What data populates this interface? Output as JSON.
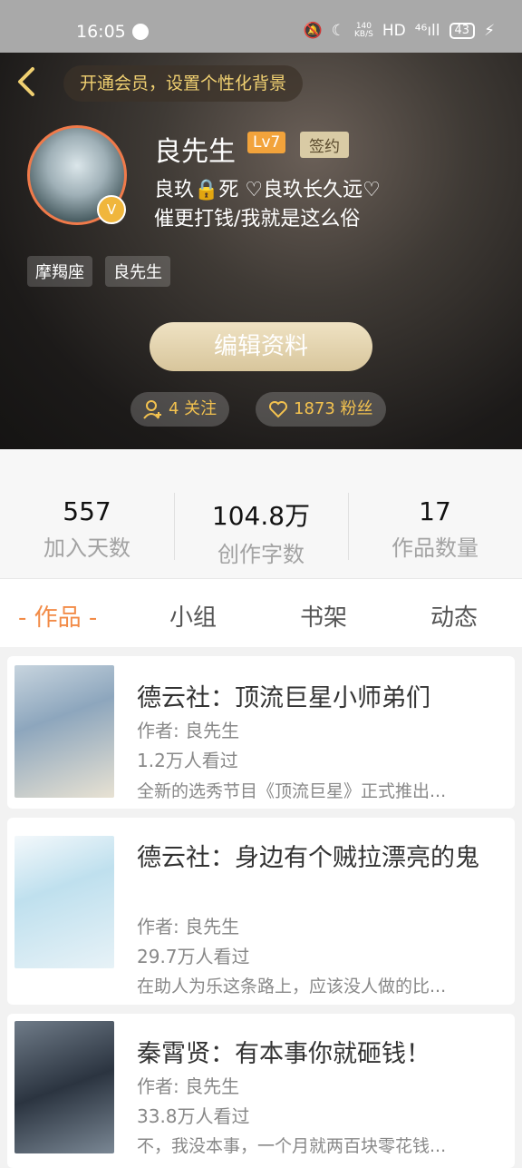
{
  "status_bar": {
    "time": "16:05",
    "net_speed_top": "140",
    "net_speed_unit": "KB/S",
    "hd": "HD",
    "signal": "⁴⁶ıll",
    "battery": "43"
  },
  "header": {
    "banner": "开通会员，设置个性化背景",
    "username": "良先生",
    "level": "Lv7",
    "sign_badge": "签约",
    "bio_line1": "良玖🔒死    ♡良玖长久远♡",
    "bio_line2": "催更打钱/我就是这么俗",
    "tags": [
      "摩羯座",
      "良先生"
    ],
    "edit_button": "编辑资料",
    "follow_label": "4 关注",
    "fans_label": "1873 粉丝"
  },
  "stats": [
    {
      "value": "557",
      "label": "加入天数"
    },
    {
      "value": "104.8万",
      "label": "创作字数"
    },
    {
      "value": "17",
      "label": "作品数量"
    }
  ],
  "tabs": [
    "- 作品 -",
    "小组",
    "书架",
    "动态"
  ],
  "works": [
    {
      "title": "德云社：顶流巨星小师弟们",
      "author": "作者: 良先生",
      "views": "1.2万人看过",
      "desc": "全新的选秀节目《顶流巨星》正式推出..."
    },
    {
      "title": "德云社：身边有个贼拉漂亮的鬼",
      "author": "作者: 良先生",
      "views": "29.7万人看过",
      "desc": "在助人为乐这条路上，应该没人做的比..."
    },
    {
      "title": "秦霄贤：有本事你就砸钱！",
      "author": "作者: 良先生",
      "views": "33.8万人看过",
      "desc": "不，我没本事，一个月就两百块零花钱..."
    }
  ]
}
